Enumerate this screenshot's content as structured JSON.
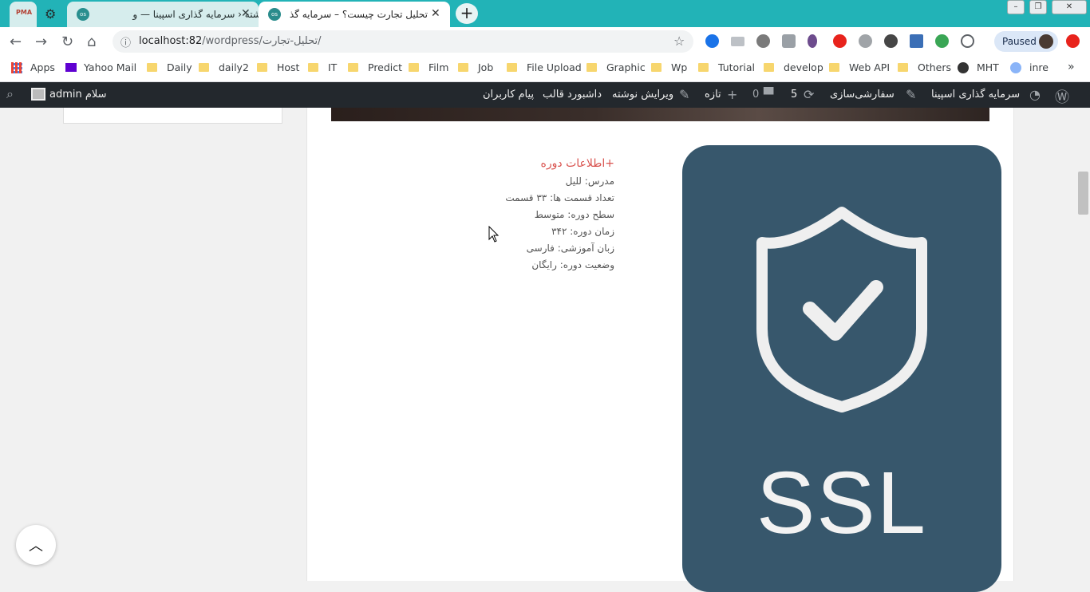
{
  "tabs": [
    {
      "title": "",
      "favicon": "PMA"
    },
    {
      "title": "ویرایش نوشته ‹ سرمایه گذاری اسپینا — و",
      "favicon": "os"
    },
    {
      "title": "تحلیل تجارت چیست؟ – سرمایه گذاری اسپ",
      "favicon": "os"
    }
  ],
  "address": {
    "host": "localhost:82",
    "path": "/wordpress/تحلیل-تجارت/"
  },
  "profile": {
    "status": "Paused"
  },
  "bookmarks": [
    "Apps",
    "Yahoo Mail",
    "Daily",
    "daily2",
    "Host",
    "IT",
    "Predict",
    "Film",
    "Job",
    "File Upload",
    "Graphic",
    "Wp",
    "Tutorial",
    "develop",
    "Web API",
    "Others",
    "MHT",
    "inre"
  ],
  "wp_admin": {
    "site_name": "سرمایه گذاری اسپینا",
    "customize": "سفارشی‌سازی",
    "updates": "5",
    "comments": "0",
    "new": "تازه",
    "edit_post": "ویرایش نوشته",
    "theme_dashboard": "داشبورد قالب",
    "user_message": "پیام کاربران",
    "greeting": "سلام admin"
  },
  "course_info": {
    "title": "+اطلاعات دوره",
    "lines": [
      "مدرس: للیل",
      "تعداد قسمت ها: ۳۳ قسمت",
      "سطح دوره: متوسط",
      "زمان دوره: ۳۴۲",
      "زبان آموزشی: فارسی",
      "وضعیت دوره: رایگان"
    ]
  },
  "image": {
    "caption": "SSL"
  },
  "colors": {
    "tab_strip": "#22b3b7",
    "accent_red": "#d9534f",
    "ssl_bg": "#37576c",
    "wp_bar": "#23282d"
  }
}
